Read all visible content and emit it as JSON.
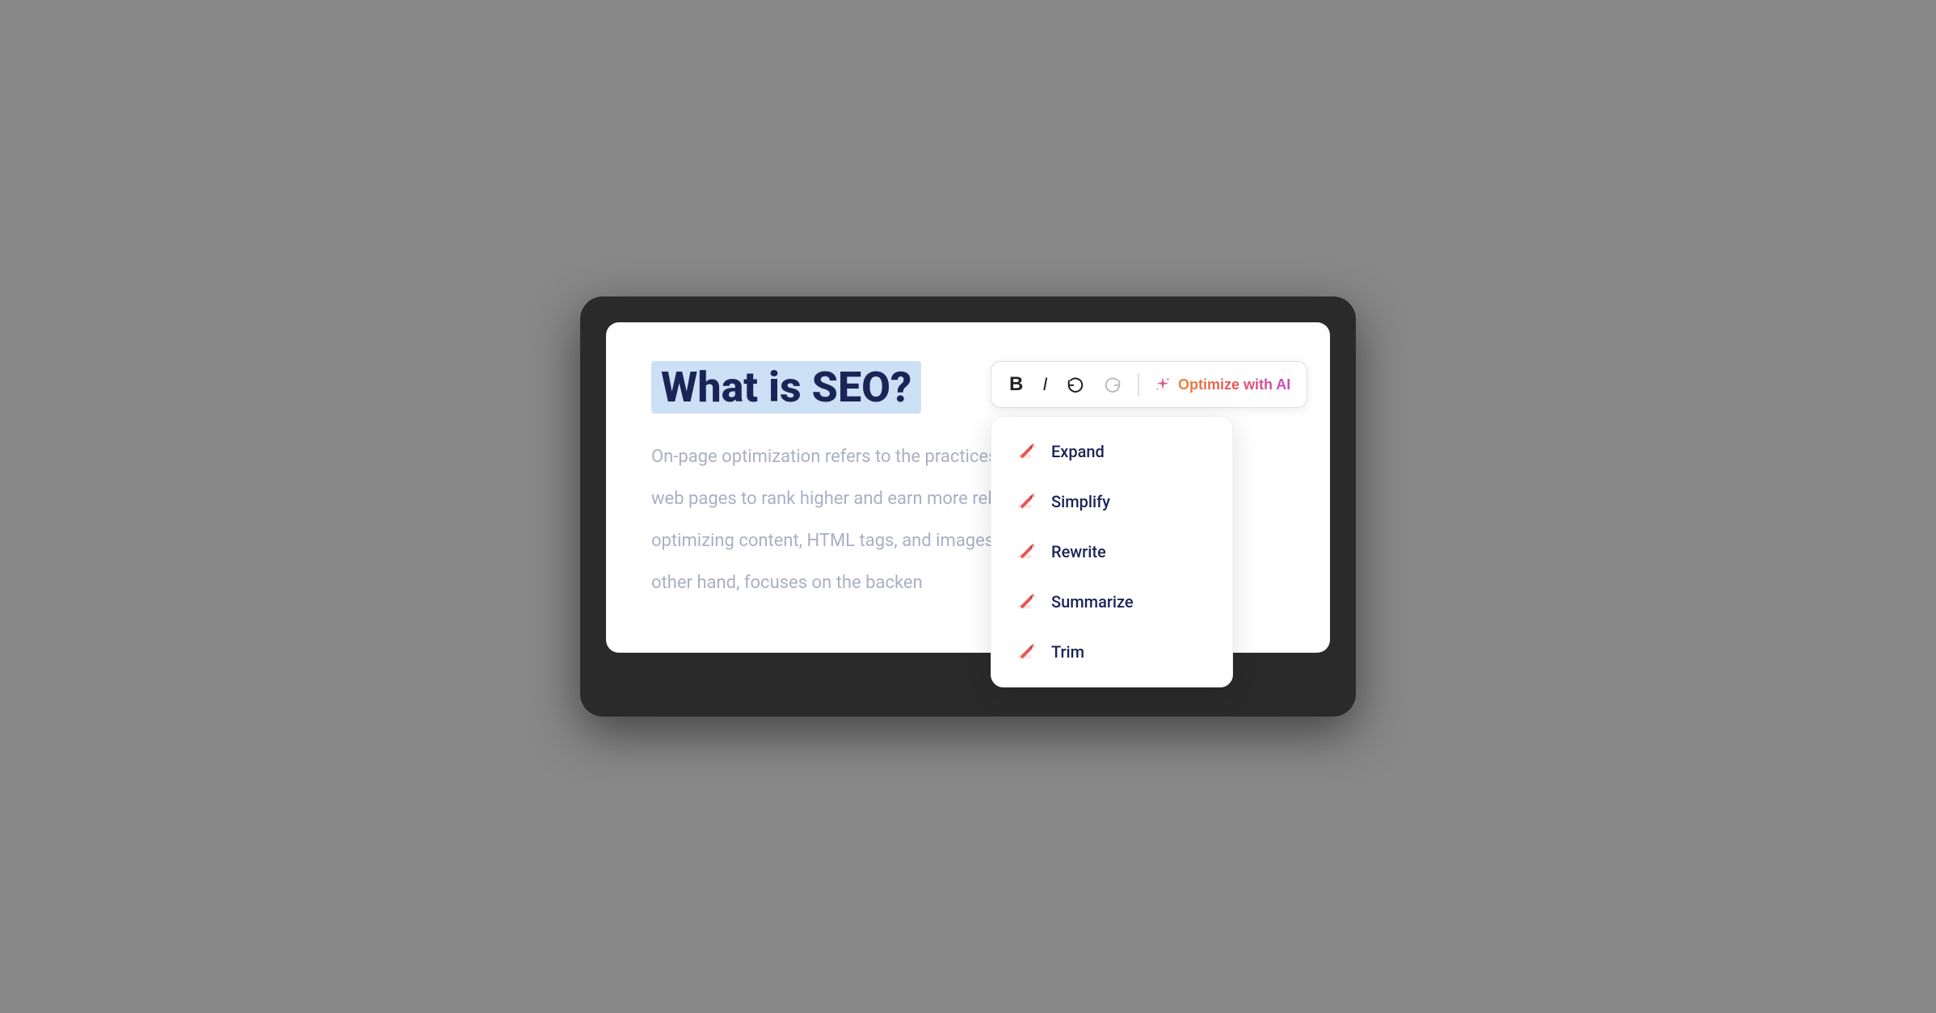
{
  "editor": {
    "title": "What is SEO?",
    "body_lines": [
      "On-page optimization refers to the practices that d",
      "web pages to rank higher and earn more relevant",
      "optimizing content, HTML tags, and images. Tech",
      "other hand, focuses on the backen"
    ]
  },
  "toolbar": {
    "bold_label": "B",
    "italic_label": "I",
    "undo_label": "↩",
    "redo_label": "↪",
    "optimize_label": "Optimize with AI"
  },
  "dropdown": {
    "items": [
      {
        "id": "expand",
        "label": "Expand"
      },
      {
        "id": "simplify",
        "label": "Simplify"
      },
      {
        "id": "rewrite",
        "label": "Rewrite"
      },
      {
        "id": "summarize",
        "label": "Summarize"
      },
      {
        "id": "trim",
        "label": "Trim"
      }
    ]
  },
  "colors": {
    "title_bg": "#cce0f5",
    "title_text": "#1a2456",
    "body_text": "#aab0c4",
    "gradient_start": "#e8843a",
    "gradient_end": "#c84bcc"
  }
}
